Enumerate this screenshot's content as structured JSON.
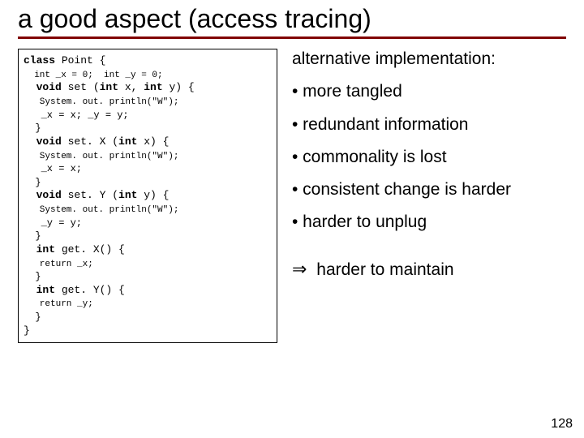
{
  "title": "a good aspect (access tracing)",
  "code": {
    "l1a": "class",
    "l1b": " Point {",
    "l2": "  int _x = 0;  int _y = 0;",
    "l3a": "  void",
    "l3b": " set (",
    "l3c": "int",
    "l3d": " x, ",
    "l3e": "int",
    "l3f": " y) {",
    "l4": "   System. out. println(\"W\");",
    "l5": "   _x = x; _y = y;",
    "l6": "  }",
    "l7a": "  void",
    "l7b": " set. X (",
    "l7c": "int",
    "l7d": " x) {",
    "l8": "   System. out. println(\"W\");",
    "l9": "   _x = x;",
    "l10": "  }",
    "l11a": "  void",
    "l11b": " set. Y (",
    "l11c": "int",
    "l11d": " y) {",
    "l12": "   System. out. println(\"W\");",
    "l13": "   _y = y;",
    "l14": "  }",
    "l15a": "  int",
    "l15b": " get. X() {",
    "l16": "   return _x;",
    "l17": "  }",
    "l18a": "  int",
    "l18b": " get. Y() {",
    "l19": "   return _y;",
    "l20": "  }",
    "l21": "}"
  },
  "right": {
    "lead": "alternative implementation:",
    "b1": "• more tangled",
    "b2": "• redundant information",
    "b3": "• commonality is lost",
    "b4": "• consistent change is harder",
    "b5": "• harder to unplug",
    "arrow": "⇒",
    "conclusion": " harder to maintain"
  },
  "pagenum": "128"
}
